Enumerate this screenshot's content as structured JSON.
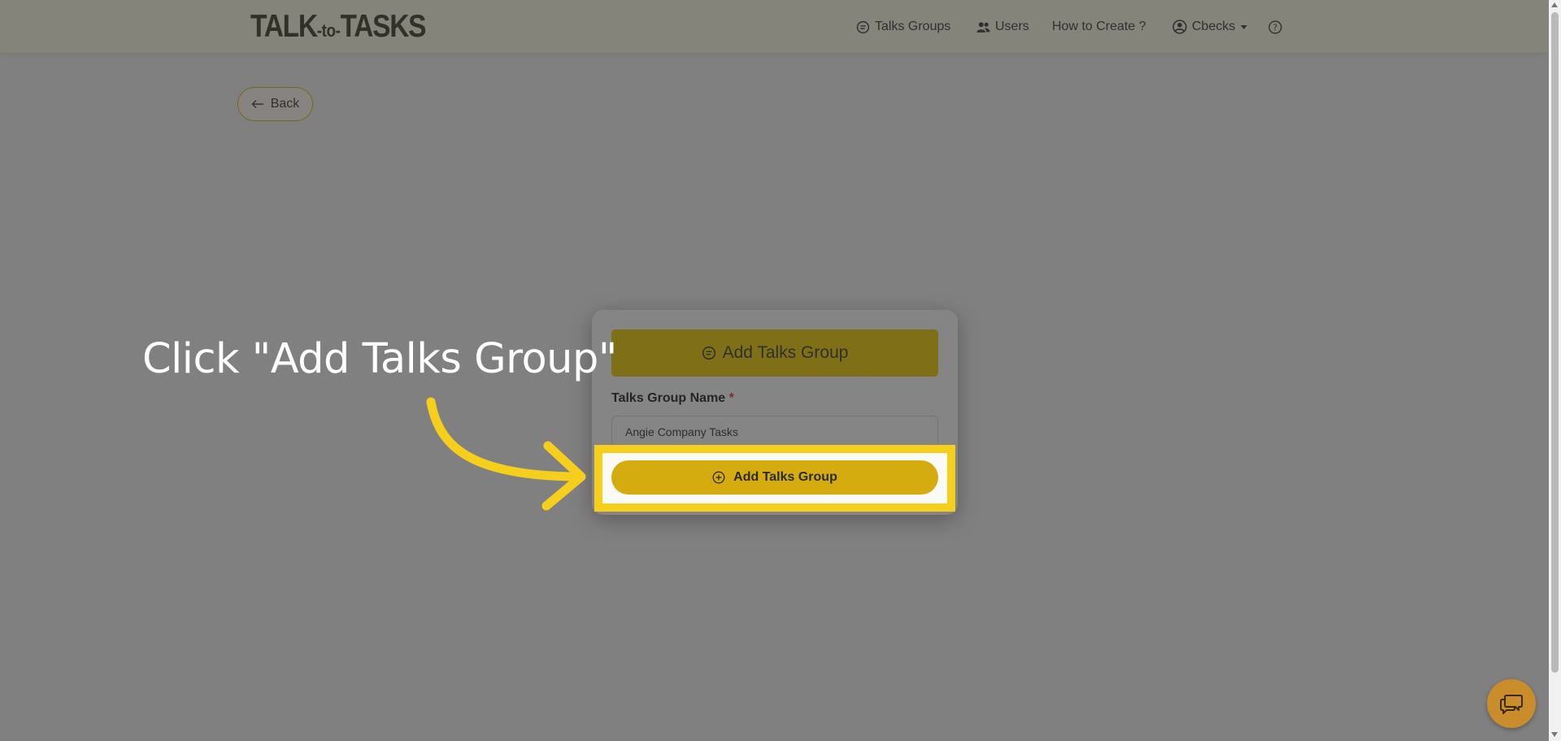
{
  "navbar": {
    "brand_left": "TALK",
    "brand_mid": "-to-",
    "brand_right": "TASKS",
    "items": [
      {
        "label": "Talks Groups",
        "icon": "chat-icon"
      },
      {
        "label": "Users",
        "icon": "users-icon"
      },
      {
        "label": "How to Create ?",
        "icon": ""
      },
      {
        "label": "Cbecks",
        "icon": "user-circle-icon"
      },
      {
        "label": "",
        "icon": "help-circle-icon"
      }
    ]
  },
  "back_button": {
    "label": "Back",
    "icon": "arrow-left-icon"
  },
  "modal": {
    "header_label": "Add Talks Group",
    "header_icon": "chat-icon",
    "field_label": "Talks Group Name",
    "required_mark": "*",
    "field_value": "Angie Company Tasks",
    "submit_label": "Add Talks Group",
    "submit_icon": "plus-circle-icon"
  },
  "tutorial": {
    "callout_text": "Click \"Add Talks Group\"",
    "highlight_color": "#f6cf1c"
  },
  "colors": {
    "accent": "#f2ce00",
    "navbar_bg": "#fffce8",
    "chat_bubble": "#c98d2c"
  }
}
